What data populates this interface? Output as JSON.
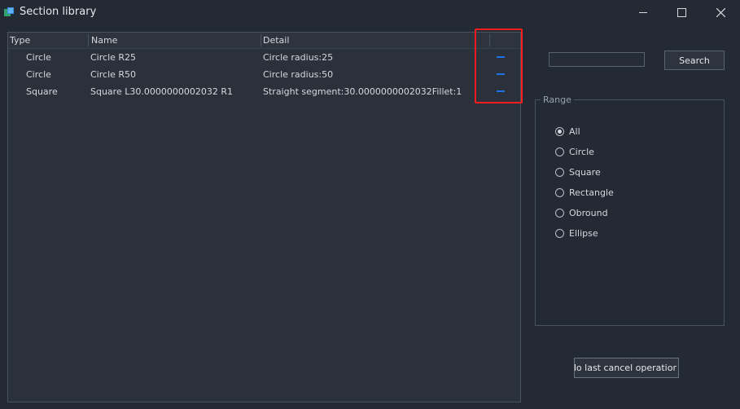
{
  "window": {
    "title": "Section library"
  },
  "table": {
    "columns": [
      "Type",
      "Name",
      "Detail"
    ],
    "rows": [
      {
        "type": "Circle",
        "name": "Circle R25",
        "detail": "Circle radius:25"
      },
      {
        "type": "Circle",
        "name": "Circle R50",
        "detail": "Circle radius:50"
      },
      {
        "type": "Square",
        "name": "Square L30.0000000002032 R1",
        "detail": "Straight segment:30.0000000002032Fillet:1"
      }
    ]
  },
  "search": {
    "value": "",
    "button_label": "Search"
  },
  "range": {
    "legend": "Range",
    "options": [
      "All",
      "Circle",
      "Square",
      "Rectangle",
      "Obround",
      "Ellipse"
    ],
    "selected": "All"
  },
  "undo": {
    "label": "Jndo last cancel operatior"
  },
  "colors": {
    "background": "#232a33",
    "accent_blue": "#1e73e8",
    "highlight_red": "#ff1c1c"
  }
}
